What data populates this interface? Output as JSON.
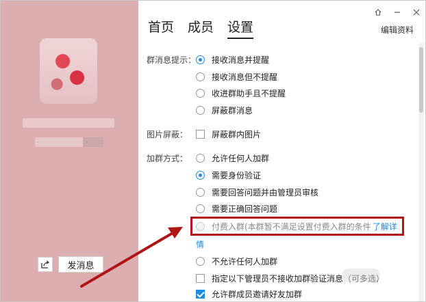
{
  "header": {
    "tabs": [
      {
        "label": "首页"
      },
      {
        "label": "成员"
      },
      {
        "label": "设置"
      }
    ],
    "edit_label": "编辑资料"
  },
  "sidebar": {
    "send_label": "发消息"
  },
  "settings": {
    "notify_label": "群消息提示：",
    "notify_options": [
      {
        "label": "接收消息并提醒",
        "checked": true
      },
      {
        "label": "接收消息但不提醒",
        "checked": false
      },
      {
        "label": "收进群助手且不提醒",
        "checked": false
      },
      {
        "label": "屏蔽群消息",
        "checked": false
      }
    ],
    "image_label": "图片屏蔽：",
    "image_option": "屏蔽群内图片",
    "join_label": "加群方式：",
    "join_options": [
      {
        "label": "允许任何人加群",
        "checked": false
      },
      {
        "label": "需要身份验证",
        "checked": true
      },
      {
        "label": "需要回答问题并由管理员审核",
        "checked": false
      },
      {
        "label": "需要正确回答问题",
        "checked": false
      },
      {
        "label": "付费入群(本群暂不满足设置付费入群的条件",
        "checked": false,
        "disabled": true
      },
      {
        "label": "不允许任何人加群",
        "checked": false
      }
    ],
    "learn_more_1": "了解详",
    "learn_more_2": "情",
    "admin_no_verify": "指定以下管理员不接收加群验证消息（可多选）",
    "allow_invite": "允许群成员邀请好友加群"
  },
  "colors": {
    "accent": "#1e8ce0",
    "left_panel": "#dcaeb0",
    "highlight": "#b01515"
  }
}
